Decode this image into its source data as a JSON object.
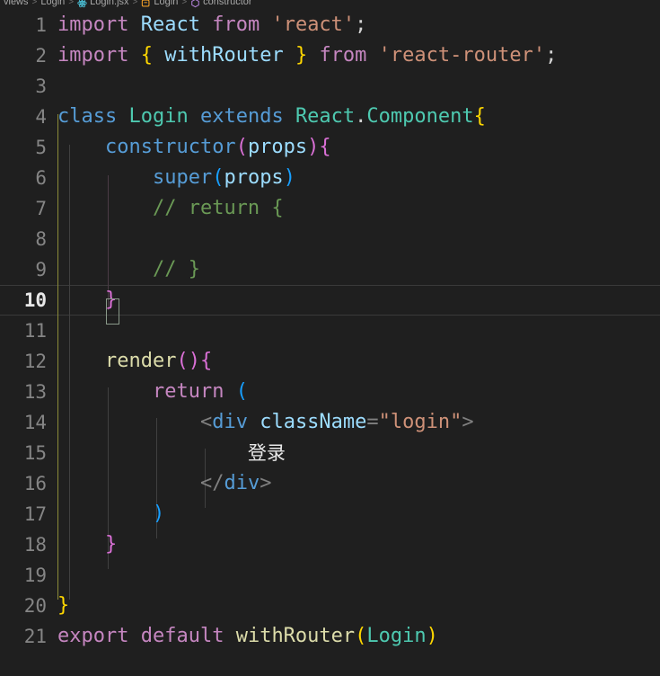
{
  "window": {
    "theme": "Dark Modern",
    "background": "#1f1f1f",
    "foreground": "#d4d4d4"
  },
  "breadcrumb": {
    "name": "breadcrumb",
    "items": [
      {
        "label": "views",
        "icon": "none"
      },
      {
        "label": "Login",
        "icon": "none"
      },
      {
        "label": "Login.jsx",
        "icon": "react-file-icon",
        "icon_color": "#4cc3d9"
      },
      {
        "label": "Login",
        "icon": "class-icon",
        "icon_color": "#ee9d28"
      },
      {
        "label": "constructor",
        "icon": "method-icon",
        "icon_color": "#b180d7"
      }
    ],
    "separator": ">"
  },
  "editor": {
    "language": "javascriptreact",
    "active_line": 10,
    "gutter": {
      "line_number_color": "#858585",
      "active_line_number_color": "#e8e8e8"
    },
    "lines": [
      {
        "number": "1",
        "tokens": [
          {
            "text": "import",
            "type": "keyword"
          },
          {
            "text": " ",
            "type": "plain"
          },
          {
            "text": "React",
            "type": "var"
          },
          {
            "text": " ",
            "type": "plain"
          },
          {
            "text": "from",
            "type": "keyword"
          },
          {
            "text": " ",
            "type": "plain"
          },
          {
            "text": "'react'",
            "type": "string"
          },
          {
            "text": ";",
            "type": "punct"
          }
        ]
      },
      {
        "number": "2",
        "tokens": [
          {
            "text": "import",
            "type": "keyword"
          },
          {
            "text": " ",
            "type": "plain"
          },
          {
            "text": "{",
            "type": "b1"
          },
          {
            "text": " ",
            "type": "plain"
          },
          {
            "text": "withRouter",
            "type": "var"
          },
          {
            "text": " ",
            "type": "plain"
          },
          {
            "text": "}",
            "type": "b1"
          },
          {
            "text": " ",
            "type": "plain"
          },
          {
            "text": "from",
            "type": "keyword"
          },
          {
            "text": " ",
            "type": "plain"
          },
          {
            "text": "'react-router'",
            "type": "string"
          },
          {
            "text": ";",
            "type": "punct"
          }
        ]
      },
      {
        "number": "3",
        "tokens": []
      },
      {
        "number": "4",
        "tokens": [
          {
            "text": "class",
            "type": "blue"
          },
          {
            "text": " ",
            "type": "plain"
          },
          {
            "text": "Login",
            "type": "class"
          },
          {
            "text": " ",
            "type": "plain"
          },
          {
            "text": "extends",
            "type": "blue"
          },
          {
            "text": " ",
            "type": "plain"
          },
          {
            "text": "React",
            "type": "class"
          },
          {
            "text": ".",
            "type": "punct"
          },
          {
            "text": "Component",
            "type": "class"
          },
          {
            "text": "{",
            "type": "b1"
          }
        ]
      },
      {
        "number": "5",
        "tokens": [
          {
            "text": "    ",
            "type": "plain"
          },
          {
            "text": "constructor",
            "type": "blue"
          },
          {
            "text": "(",
            "type": "b2"
          },
          {
            "text": "props",
            "type": "var"
          },
          {
            "text": ")",
            "type": "b2"
          },
          {
            "text": "{",
            "type": "b2"
          }
        ]
      },
      {
        "number": "6",
        "tokens": [
          {
            "text": "        ",
            "type": "plain"
          },
          {
            "text": "super",
            "type": "blue"
          },
          {
            "text": "(",
            "type": "b3"
          },
          {
            "text": "props",
            "type": "var"
          },
          {
            "text": ")",
            "type": "b3"
          }
        ]
      },
      {
        "number": "7",
        "tokens": [
          {
            "text": "        ",
            "type": "plain"
          },
          {
            "text": "// return {",
            "type": "comment"
          }
        ]
      },
      {
        "number": "8",
        "tokens": []
      },
      {
        "number": "9",
        "tokens": [
          {
            "text": "        ",
            "type": "plain"
          },
          {
            "text": "// }",
            "type": "comment"
          }
        ]
      },
      {
        "number": "10",
        "active": true,
        "tokens": [
          {
            "text": "    ",
            "type": "plain"
          },
          {
            "text": "}",
            "type": "b2"
          }
        ]
      },
      {
        "number": "11",
        "tokens": []
      },
      {
        "number": "12",
        "tokens": [
          {
            "text": "    ",
            "type": "plain"
          },
          {
            "text": "render",
            "type": "func"
          },
          {
            "text": "(",
            "type": "b2"
          },
          {
            "text": ")",
            "type": "b2"
          },
          {
            "text": "{",
            "type": "b2"
          }
        ]
      },
      {
        "number": "13",
        "tokens": [
          {
            "text": "        ",
            "type": "plain"
          },
          {
            "text": "return",
            "type": "keyword"
          },
          {
            "text": " ",
            "type": "plain"
          },
          {
            "text": "(",
            "type": "b3"
          }
        ]
      },
      {
        "number": "14",
        "tokens": [
          {
            "text": "            ",
            "type": "plain"
          },
          {
            "text": "<",
            "type": "tag"
          },
          {
            "text": "div",
            "type": "tagname"
          },
          {
            "text": " ",
            "type": "plain"
          },
          {
            "text": "className",
            "type": "attr"
          },
          {
            "text": "=",
            "type": "tag"
          },
          {
            "text": "\"login\"",
            "type": "string"
          },
          {
            "text": ">",
            "type": "tag"
          }
        ]
      },
      {
        "number": "15",
        "tokens": [
          {
            "text": "                ",
            "type": "plain"
          },
          {
            "text": "登录",
            "type": "cjk"
          }
        ]
      },
      {
        "number": "16",
        "tokens": [
          {
            "text": "            ",
            "type": "plain"
          },
          {
            "text": "</",
            "type": "tag"
          },
          {
            "text": "div",
            "type": "tagname"
          },
          {
            "text": ">",
            "type": "tag"
          }
        ]
      },
      {
        "number": "17",
        "tokens": [
          {
            "text": "        ",
            "type": "plain"
          },
          {
            "text": ")",
            "type": "b3"
          }
        ]
      },
      {
        "number": "18",
        "tokens": [
          {
            "text": "    ",
            "type": "plain"
          },
          {
            "text": "}",
            "type": "b2"
          }
        ]
      },
      {
        "number": "19",
        "tokens": []
      },
      {
        "number": "20",
        "tokens": [
          {
            "text": "}",
            "type": "b1"
          }
        ]
      },
      {
        "number": "21",
        "tokens": [
          {
            "text": "export",
            "type": "keyword"
          },
          {
            "text": " ",
            "type": "plain"
          },
          {
            "text": "default",
            "type": "keyword"
          },
          {
            "text": " ",
            "type": "plain"
          },
          {
            "text": "withRouter",
            "type": "func"
          },
          {
            "text": "(",
            "type": "b1"
          },
          {
            "text": "Login",
            "type": "class"
          },
          {
            "text": ")",
            "type": "b1"
          }
        ]
      }
    ]
  }
}
